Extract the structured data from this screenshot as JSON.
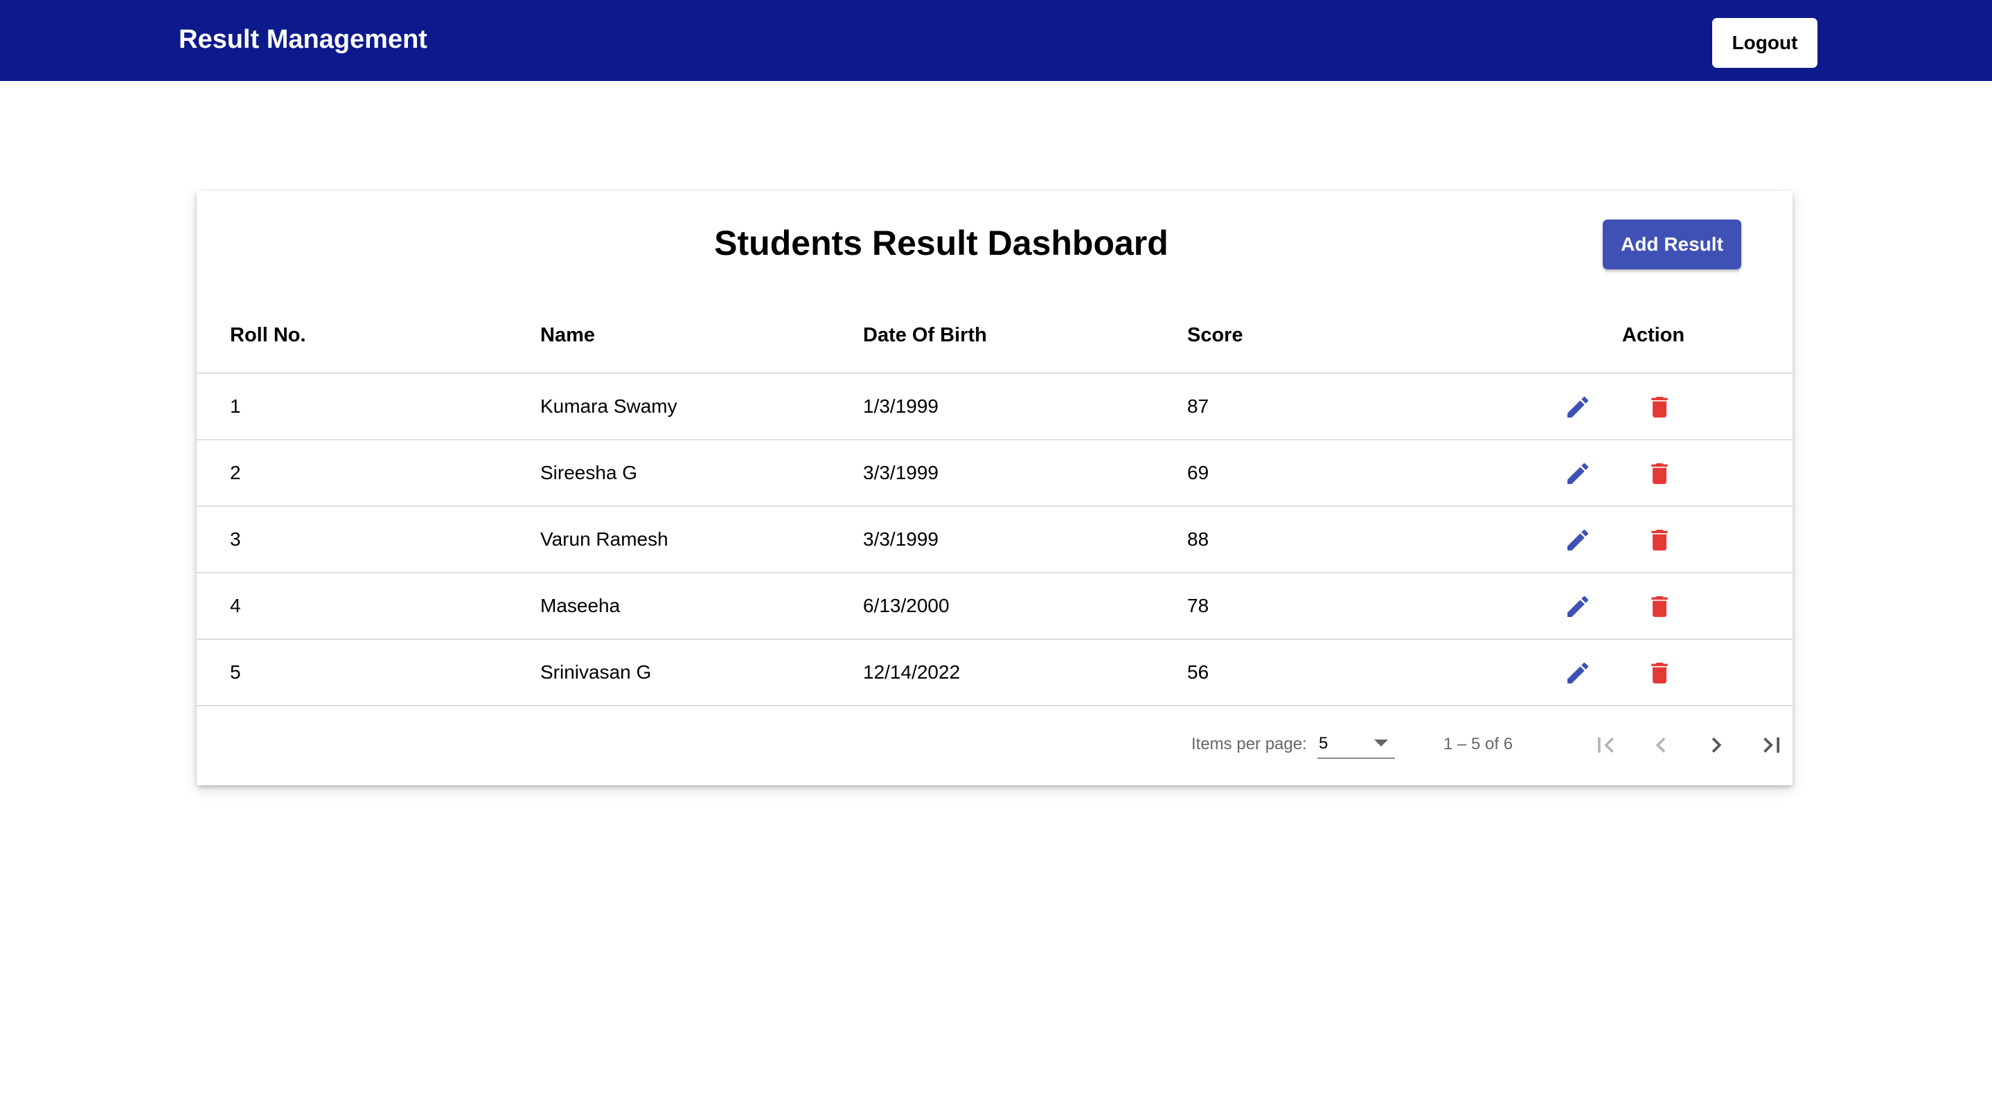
{
  "app": {
    "title": "Result Management",
    "logout_label": "Logout",
    "topbar_color": "#0c1a8c"
  },
  "dashboard": {
    "title": "Students Result Dashboard",
    "add_label": "Add Result",
    "accent_color": "#3f51b5",
    "delete_color": "#e53935"
  },
  "table": {
    "headers": {
      "roll": "Roll No.",
      "name": "Name",
      "dob": "Date Of Birth",
      "score": "Score",
      "action": "Action"
    },
    "rows": [
      {
        "roll": "1",
        "name": "Kumara Swamy",
        "dob": "1/3/1999",
        "score": "87"
      },
      {
        "roll": "2",
        "name": "Sireesha G",
        "dob": "3/3/1999",
        "score": "69"
      },
      {
        "roll": "3",
        "name": "Varun Ramesh",
        "dob": "3/3/1999",
        "score": "88"
      },
      {
        "roll": "4",
        "name": "Maseeha",
        "dob": "6/13/2000",
        "score": "78"
      },
      {
        "roll": "5",
        "name": "Srinivasan G",
        "dob": "12/14/2022",
        "score": "56"
      }
    ],
    "row_action_icons": [
      "pencil-icon",
      "trash-icon"
    ]
  },
  "paginator": {
    "items_per_page_label": "Items per page:",
    "items_per_page_value": "5",
    "range_label": "1 – 5 of 6",
    "icons": [
      "first-page-icon",
      "chevron-left-icon",
      "chevron-right-icon",
      "last-page-icon"
    ]
  }
}
